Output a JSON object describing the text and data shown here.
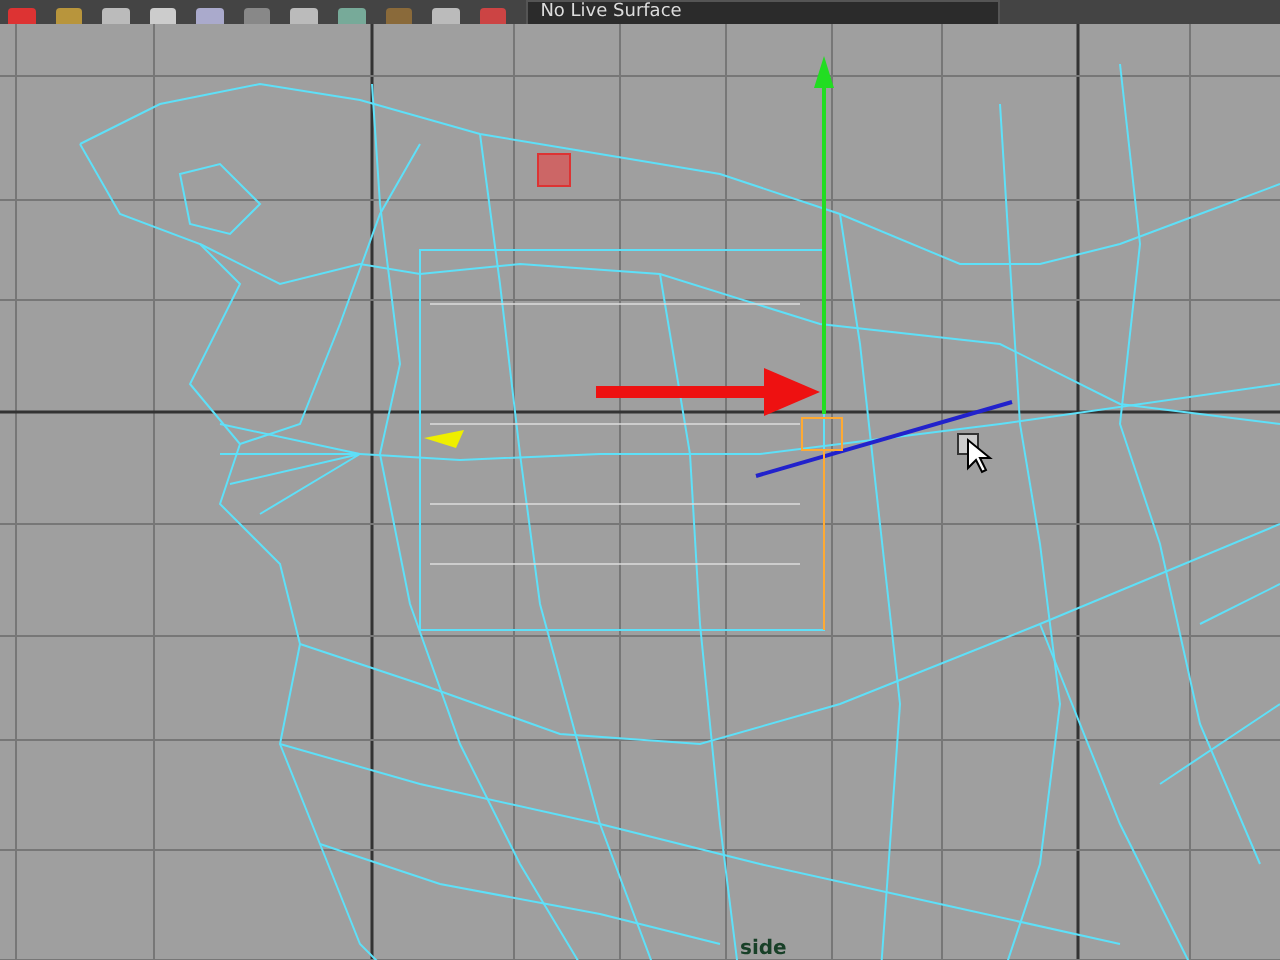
{
  "toolbar": {
    "live_surface_field": {
      "value": "No Live Surface"
    }
  },
  "viewport": {
    "camera_label": "side"
  }
}
